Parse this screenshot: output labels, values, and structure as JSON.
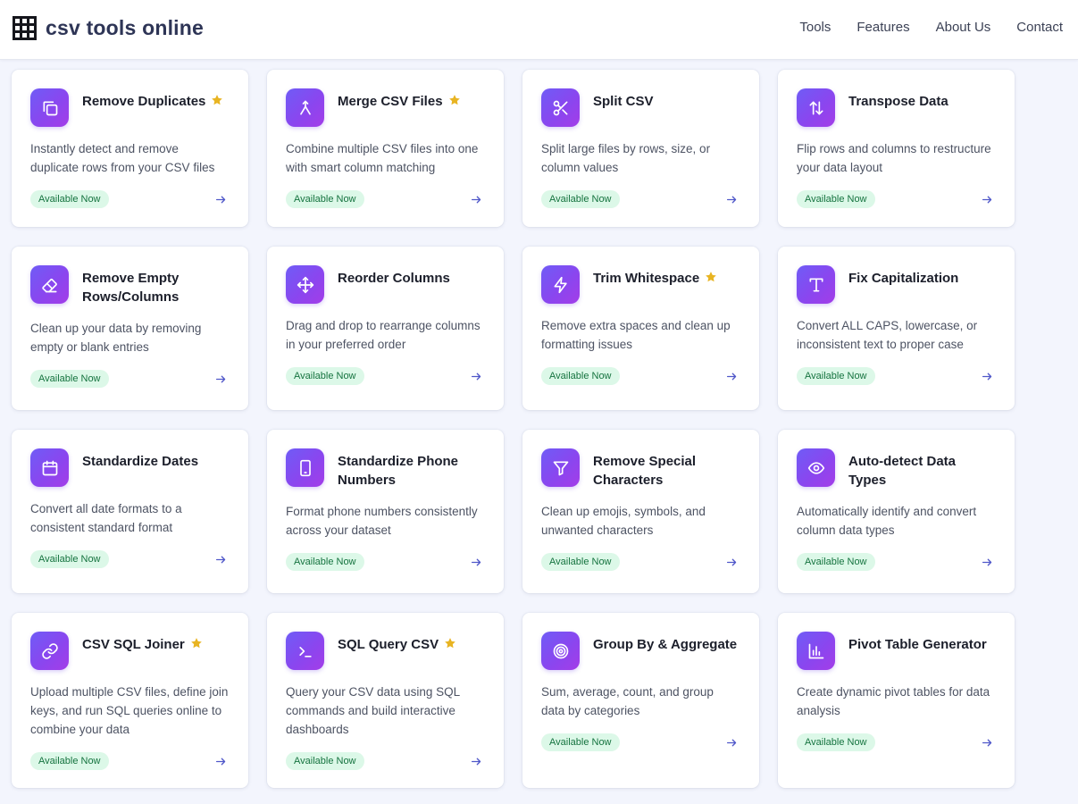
{
  "header": {
    "logo_text": "csv tools online",
    "nav": [
      "Tools",
      "Features",
      "About Us",
      "Contact"
    ]
  },
  "colors": {
    "accent_start": "#6f5cf6",
    "accent_end": "#a33de8",
    "badge_bg": "#dcf8e8",
    "badge_text": "#15733f",
    "star": "#e8b422",
    "arrow": "#4f57c9"
  },
  "tools": [
    {
      "title": "Remove Duplicates",
      "featured": true,
      "icon": "copy-icon",
      "description": "Instantly detect and remove duplicate rows from your CSV files",
      "badge": "Available Now"
    },
    {
      "title": "Merge CSV Files",
      "featured": true,
      "icon": "merge-icon",
      "description": "Combine multiple CSV files into one with smart column matching",
      "badge": "Available Now"
    },
    {
      "title": "Split CSV",
      "featured": false,
      "icon": "scissors-icon",
      "description": "Split large files by rows, size, or column values",
      "badge": "Available Now"
    },
    {
      "title": "Transpose Data",
      "featured": false,
      "icon": "swap-vertical-icon",
      "description": "Flip rows and columns to restructure your data layout",
      "badge": "Available Now"
    },
    {
      "title": "Remove Empty Rows/Columns",
      "featured": false,
      "icon": "eraser-icon",
      "description": "Clean up your data by removing empty or blank entries",
      "badge": "Available Now"
    },
    {
      "title": "Reorder Columns",
      "featured": false,
      "icon": "move-icon",
      "description": "Drag and drop to rearrange columns in your preferred order",
      "badge": "Available Now"
    },
    {
      "title": "Trim Whitespace",
      "featured": true,
      "icon": "lightning-icon",
      "description": "Remove extra spaces and clean up formatting issues",
      "badge": "Available Now"
    },
    {
      "title": "Fix Capitalization",
      "featured": false,
      "icon": "type-icon",
      "description": "Convert ALL CAPS, lowercase, or inconsistent text to proper case",
      "badge": "Available Now"
    },
    {
      "title": "Standardize Dates",
      "featured": false,
      "icon": "calendar-icon",
      "description": "Convert all date formats to a consistent standard format",
      "badge": "Available Now"
    },
    {
      "title": "Standardize Phone Numbers",
      "featured": false,
      "icon": "phone-icon",
      "description": "Format phone numbers consistently across your dataset",
      "badge": "Available Now"
    },
    {
      "title": "Remove Special Characters",
      "featured": false,
      "icon": "filter-icon",
      "description": "Clean up emojis, symbols, and unwanted characters",
      "badge": "Available Now"
    },
    {
      "title": "Auto-detect Data Types",
      "featured": false,
      "icon": "eye-icon",
      "description": "Automatically identify and convert column data types",
      "badge": "Available Now"
    },
    {
      "title": "CSV SQL Joiner",
      "featured": true,
      "icon": "link-icon",
      "description": "Upload multiple CSV files, define join keys, and run SQL queries online to combine your data",
      "badge": "Available Now"
    },
    {
      "title": "SQL Query CSV",
      "featured": true,
      "icon": "terminal-icon",
      "description": "Query your CSV data using SQL commands and build interactive dashboards",
      "badge": "Available Now"
    },
    {
      "title": "Group By & Aggregate",
      "featured": false,
      "icon": "target-icon",
      "description": "Sum, average, count, and group data by categories",
      "badge": "Available Now"
    },
    {
      "title": "Pivot Table Generator",
      "featured": false,
      "icon": "bar-chart-icon",
      "description": "Create dynamic pivot tables for data analysis",
      "badge": "Available Now"
    }
  ]
}
